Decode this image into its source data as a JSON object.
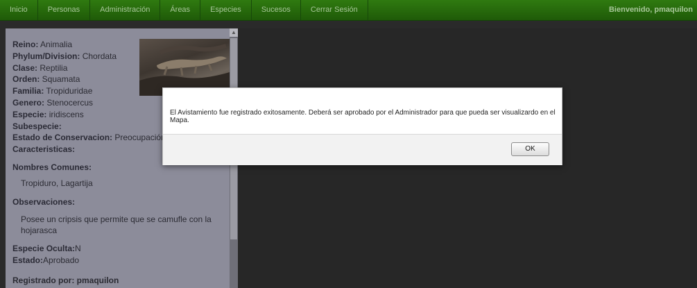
{
  "nav": {
    "items": [
      "Inicio",
      "Personas",
      "Administración",
      "Áreas",
      "Especies",
      "Sucesos",
      "Cerrar Sesión"
    ],
    "welcome": "Bienvenido, pmaquilon"
  },
  "species": {
    "fields": [
      {
        "label": "Reino:",
        "value": " Animalia"
      },
      {
        "label": "Phylum/Division:",
        "value": " Chordata"
      },
      {
        "label": "Clase:",
        "value": " Reptilia"
      },
      {
        "label": "Orden:",
        "value": " Squamata"
      },
      {
        "label": "Familia:",
        "value": " Tropiduridae"
      },
      {
        "label": "Genero:",
        "value": " Stenocercus"
      },
      {
        "label": "Especie:",
        "value": " iridiscens"
      },
      {
        "label": "Subespecie:",
        "value": ""
      },
      {
        "label": "Estado de Conservacion:",
        "value": " Preocupación M"
      },
      {
        "label": "Caracteristicas:",
        "value": ""
      }
    ],
    "common_names_title": "Nombres Comunes:",
    "common_names": "Tropiduro, Lagartija",
    "observations_title": "Observaciones:",
    "observations": "Posee un cripsis que permite que se camufle con la hojarasca",
    "hidden_label": "Especie Oculta:",
    "hidden_value": "N",
    "status_label": "Estado:",
    "status_value": "Aprobado",
    "registered_by": "Registrado por: pmaquilon"
  },
  "dialog": {
    "message": "El Avistamiento fue registrado exitosamente. Deberá ser aprobado por el Administrador para que pueda ser visualizardo en el Mapa.",
    "ok_label": "OK"
  }
}
